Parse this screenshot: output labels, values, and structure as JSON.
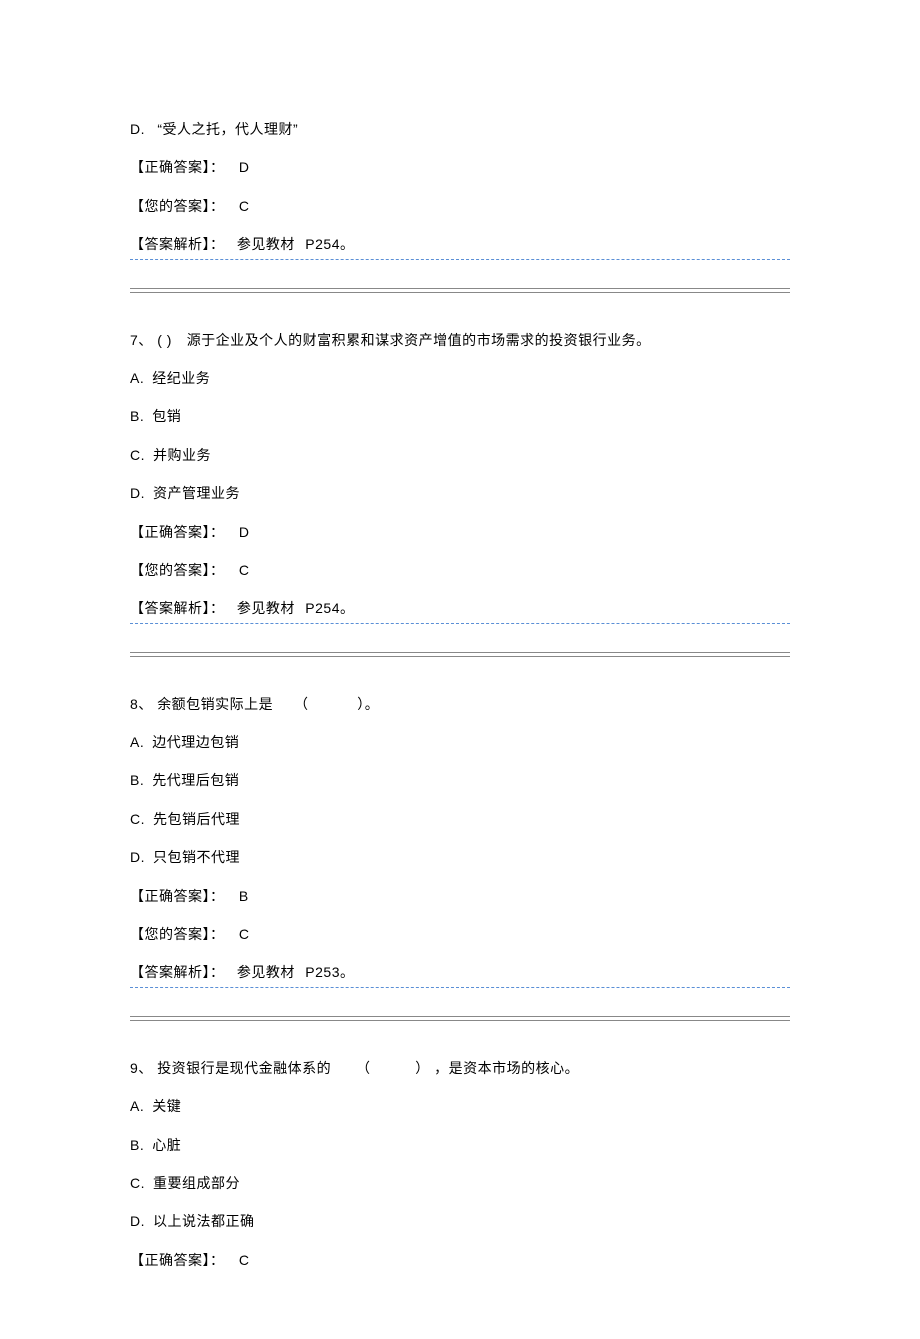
{
  "labels": {
    "correct_answer": "【正确答案】：",
    "your_answer": "【您的答案】：",
    "analysis": "【答案解析】：",
    "analysis_prefix": "参见教材"
  },
  "q6": {
    "option_d_letter": "D.",
    "option_d_text": "“受人之托，代人理财”",
    "correct": "D",
    "your": "C",
    "analysis_ref": "P254。"
  },
  "q7": {
    "number": "7、",
    "stem_before": "( )",
    "stem_after": "源于企业及个人的财富积累和谋求资产增值的市场需求的投资银行业务。",
    "a_letter": "A.",
    "a_text": "经纪业务",
    "b_letter": "B.",
    "b_text": "包销",
    "c_letter": "C.",
    "c_text": "并购业务",
    "d_letter": "D.",
    "d_text": "资产管理业务",
    "correct": "D",
    "your": "C",
    "analysis_ref": "P254。"
  },
  "q8": {
    "number": "8、",
    "stem_before": "余额包销实际上是",
    "paren_open": "（",
    "paren_close": "）。",
    "a_letter": "A.",
    "a_text": "边代理边包销",
    "b_letter": "B.",
    "b_text": "先代理后包销",
    "c_letter": "C.",
    "c_text": "先包销后代理",
    "d_letter": "D.",
    "d_text": "只包销不代理",
    "correct": "B",
    "your": "C",
    "analysis_ref": "P253。"
  },
  "q9": {
    "number": "9、",
    "stem_before": "投资银行是现代金融体系的",
    "paren_open": "（",
    "paren_close": "）",
    "stem_after": "，是资本市场的核心。",
    "a_letter": "A.",
    "a_text": "关键",
    "b_letter": "B.",
    "b_text": "心脏",
    "c_letter": "C.",
    "c_text": "重要组成部分",
    "d_letter": "D.",
    "d_text": "以上说法都正确",
    "correct": "C"
  }
}
